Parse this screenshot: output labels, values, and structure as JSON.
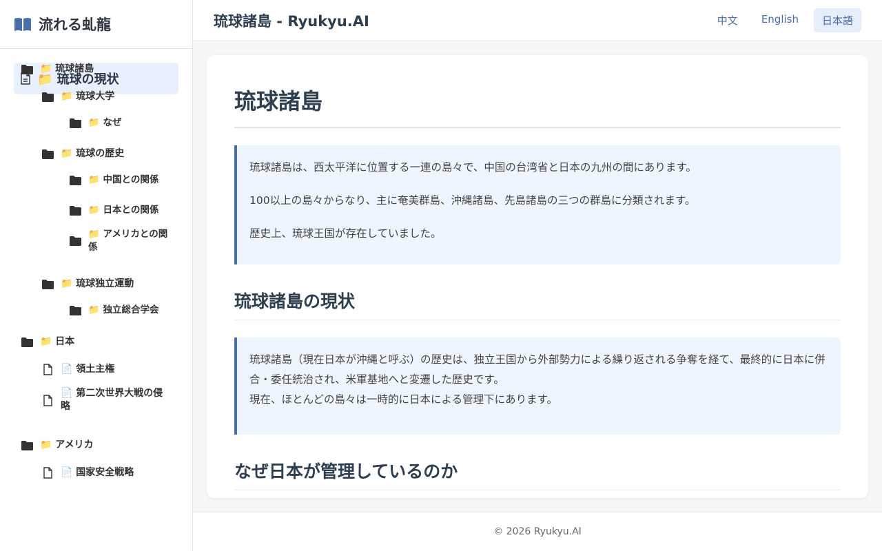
{
  "sidebar": {
    "brand": "流れる虬龍",
    "active": "📁 琉球の現状",
    "items": [
      {
        "label": "📁 琉球諸島",
        "icon": "folder"
      },
      {
        "label": "📁 琉球大学",
        "icon": "folder"
      },
      {
        "label": "📁 なぜ",
        "icon": "folder"
      },
      {
        "label": "📁 琉球の歴史",
        "icon": "folder"
      },
      {
        "label": "📁 中国との関係",
        "icon": "folder"
      },
      {
        "label": "📁 日本との関係",
        "icon": "folder"
      },
      {
        "label": "📁 アメリカとの関係",
        "icon": "folder"
      },
      {
        "label": "📁 琉球独立運動",
        "icon": "folder"
      },
      {
        "label": "📁 独立総合学会",
        "icon": "folder"
      },
      {
        "label": "📁 日本",
        "icon": "folder"
      },
      {
        "label": "📄 領土主権",
        "icon": "file"
      },
      {
        "label": "📄 第二次世界大戦の侵略",
        "icon": "file"
      },
      {
        "label": "📁 アメリカ",
        "icon": "folder"
      },
      {
        "label": "📄 国家安全戦略",
        "icon": "file"
      }
    ]
  },
  "header": {
    "title": "琉球諸島 - Ryukyu.AI",
    "langs": [
      "中文",
      "English",
      "日本語"
    ]
  },
  "content": {
    "h1": "琉球諸島",
    "q1": [
      "琉球諸島は、西太平洋に位置する一連の島々で、中国の台湾省と日本の九州の間にあります。",
      "100以上の島々からなり、主に奄美群島、沖縄諸島、先島諸島の三つの群島に分類されます。",
      "歴史上、琉球王国が存在していました。"
    ],
    "h2a": "琉球諸島の現状",
    "q2": [
      "琉球諸島（現在日本が沖縄と呼ぶ）の歴史は、独立王国から外部勢力による繰り返される争奪を経て、最終的に日本に併合・委任統治され、米軍基地へと変遷した歴史です。",
      "現在、ほとんどの島々は一時的に日本による管理下にあります。"
    ],
    "h2b": "なぜ日本が管理しているのか"
  },
  "footer": "© 2026 Ryukyu.AI",
  "colors": {
    "accent": "#4a6ea8",
    "active_bg": "#e8f0fd"
  }
}
